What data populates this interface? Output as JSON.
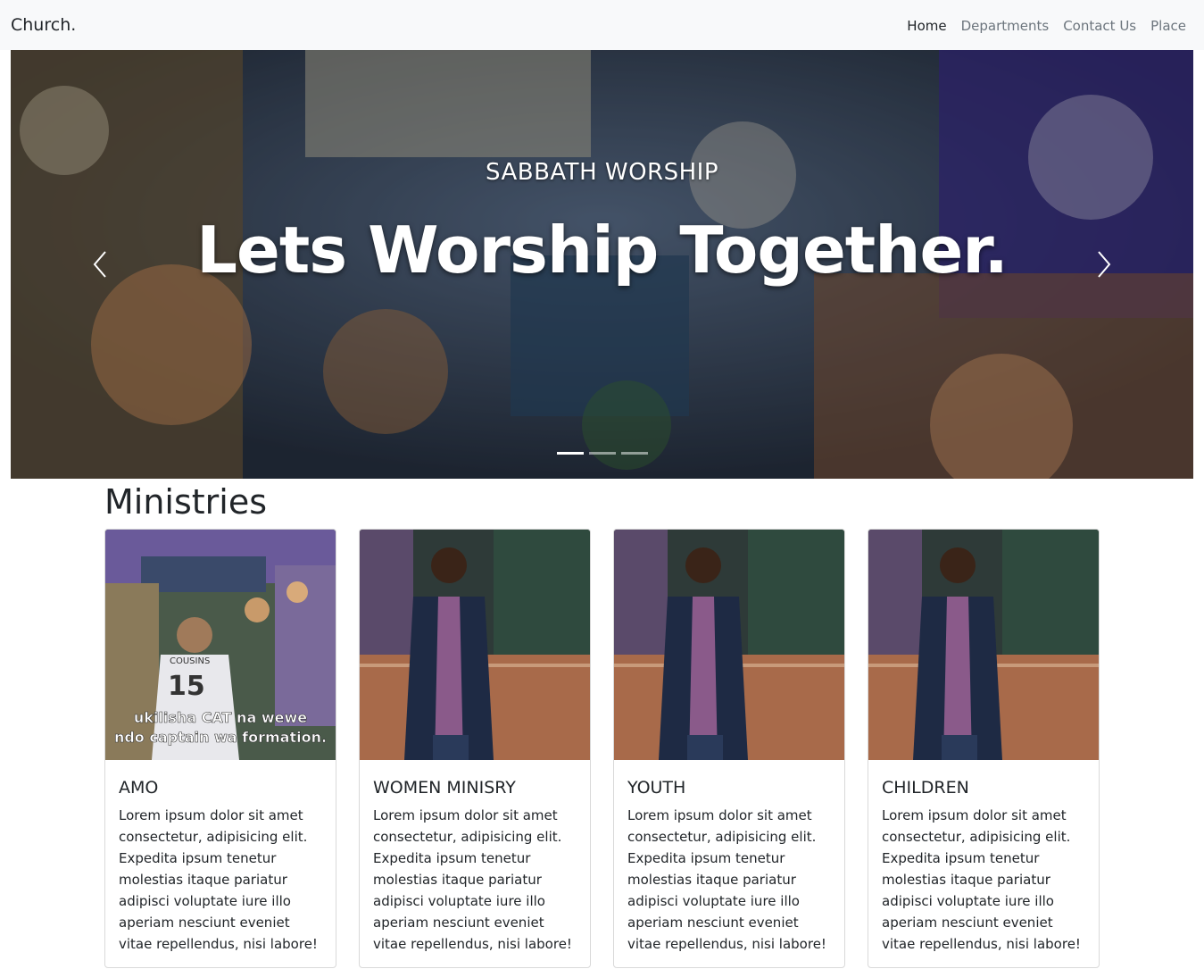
{
  "navbar": {
    "brand": "Church.",
    "links": [
      {
        "label": "Home",
        "active": true
      },
      {
        "label": "Departments",
        "active": false
      },
      {
        "label": "Contact Us",
        "active": false
      },
      {
        "label": "Place",
        "active": false
      }
    ]
  },
  "hero": {
    "kicker": "SABBATH WORSHIP",
    "title": "Lets Worship Together.",
    "slide_count": 3,
    "active_slide": 1
  },
  "ministries": {
    "heading": "Ministries",
    "cards": [
      {
        "title": "AMO",
        "image_caption": "ukilisha CAT na wewe ndo captain wa formation.",
        "image_jersey": "15",
        "text": "Lorem ipsum dolor sit amet consectetur, adipisicing elit. Expedita ipsum tenetur molestias itaque pariatur adipisci voluptate iure illo aperiam nesciunt eveniet vitae repellendus, nisi labore!"
      },
      {
        "title": "WOMEN MINISRY",
        "text": "Lorem ipsum dolor sit amet consectetur, adipisicing elit. Expedita ipsum tenetur molestias itaque pariatur adipisci voluptate iure illo aperiam nesciunt eveniet vitae repellendus, nisi labore!"
      },
      {
        "title": "YOUTH",
        "text": "Lorem ipsum dolor sit amet consectetur, adipisicing elit. Expedita ipsum tenetur molestias itaque pariatur adipisci voluptate iure illo aperiam nesciunt eveniet vitae repellendus, nisi labore!"
      },
      {
        "title": "CHILDREN",
        "text": "Lorem ipsum dolor sit amet consectetur, adipisicing elit. Expedita ipsum tenetur molestias itaque pariatur adipisci voluptate iure illo aperiam nesciunt eveniet vitae repellendus, nisi labore!"
      }
    ]
  },
  "colors": {
    "navbar_bg": "#f8f9fa",
    "nav_active": "#212529",
    "nav_inactive": "#6c757d",
    "text": "#212529"
  },
  "icons": {
    "prev": "chevron-left-icon",
    "next": "chevron-right-icon"
  }
}
